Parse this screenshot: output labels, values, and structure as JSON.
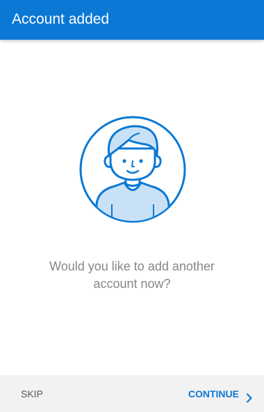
{
  "header": {
    "title": "Account added"
  },
  "illustration": {
    "icon": "user-avatar-icon"
  },
  "prompt": {
    "line1": "Would you like to add another",
    "line2": "account now?"
  },
  "footer": {
    "skip_label": "SKIP",
    "continue_label": "CONTINUE",
    "continue_icon": "chevron-right-icon"
  },
  "colors": {
    "accent": "#0a78d4",
    "header_text": "#ffffff",
    "body_text": "#878787",
    "footer_bg": "#f2f2f2",
    "skip_text": "#555555"
  }
}
